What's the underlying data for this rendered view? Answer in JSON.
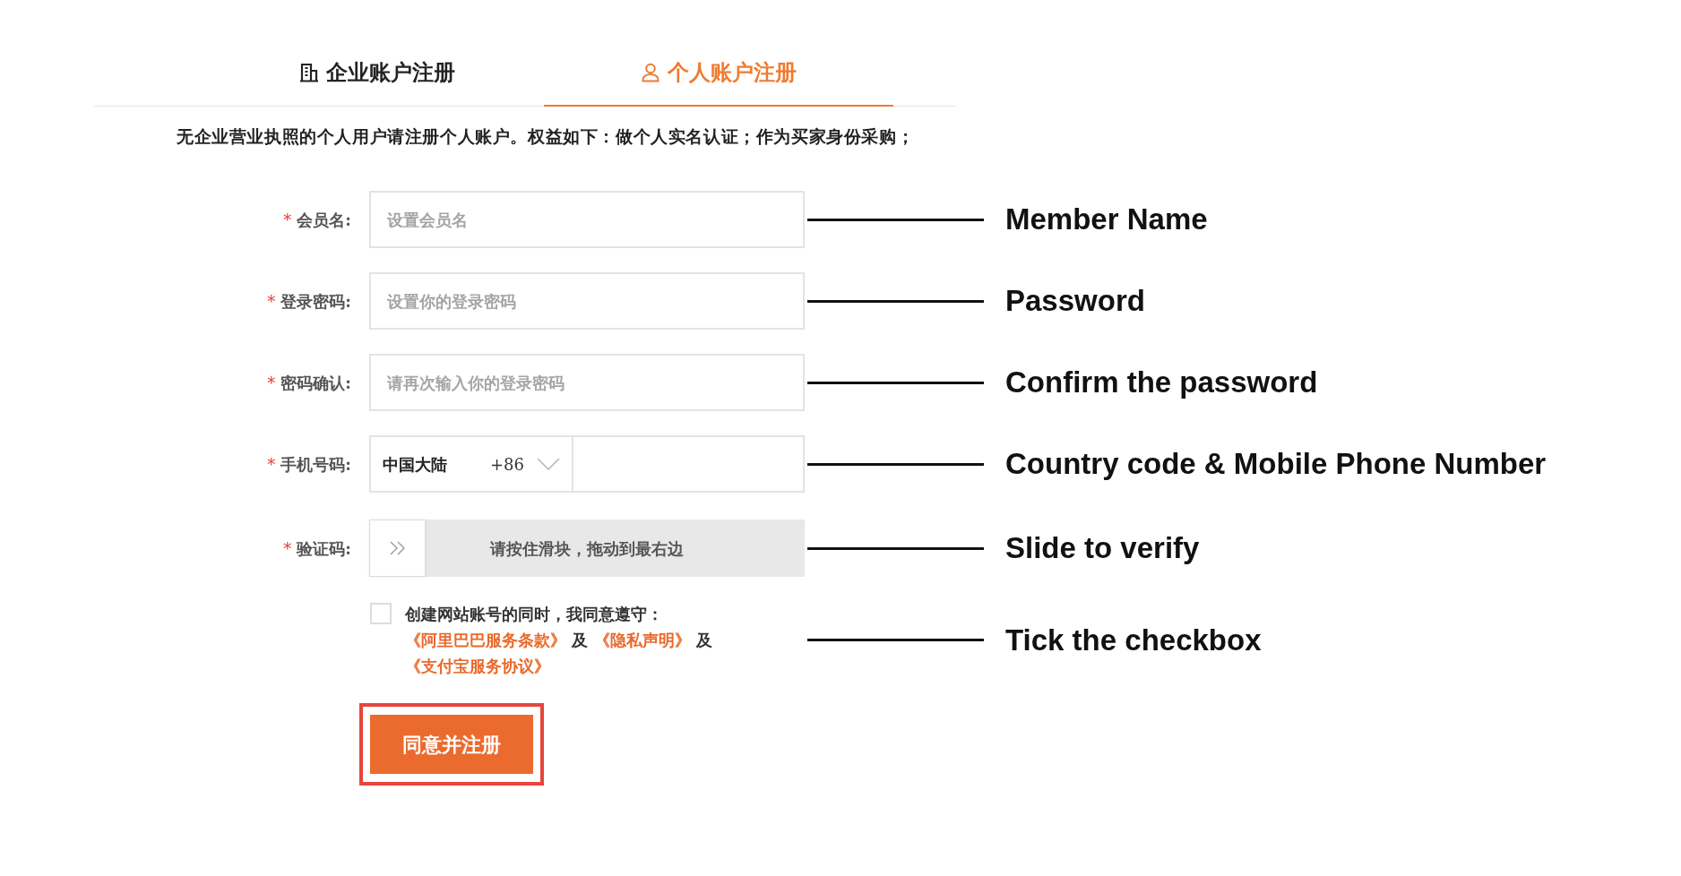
{
  "tabs": [
    {
      "kind": "company",
      "label": "企业账户注册",
      "selected": false
    },
    {
      "kind": "person",
      "label": "个人账户注册",
      "selected": true
    }
  ],
  "notice": "无企业营业执照的个人用户请注册个人账户。权益如下：做个人实名认证；作为买家身份采购；",
  "fields": [
    {
      "kind": "text",
      "required_mark": "*",
      "label": "会员名:",
      "placeholder": "设置会员名",
      "annotation": "Member Name"
    },
    {
      "kind": "text",
      "required_mark": "*",
      "label": "登录密码:",
      "placeholder": "设置你的登录密码",
      "annotation": "Password"
    },
    {
      "kind": "text",
      "required_mark": "*",
      "label": "密码确认:",
      "placeholder": "请再次输入你的登录密码",
      "annotation": "Confirm the password"
    },
    {
      "kind": "phone",
      "required_mark": "*",
      "label": "手机号码:",
      "country": "中国大陆",
      "code": "+86",
      "annotation": "Country code & Mobile Phone Number"
    },
    {
      "kind": "slider",
      "required_mark": "*",
      "label": "验证码:",
      "hint": "请按住滑块，拖动到最右边",
      "level": 0,
      "annotation": "Slide to verify"
    }
  ],
  "agreement": {
    "checked": false,
    "intro": "创建网站账号的同时，我同意遵守：",
    "parts": [
      {
        "kind": "link",
        "text": "《阿里巴巴服务条款》"
      },
      {
        "kind": "text",
        "text": "及"
      },
      {
        "kind": "link",
        "text": "《隐私声明》"
      },
      {
        "kind": "text",
        "text": "及"
      },
      {
        "kind": "link",
        "text": "《支付宝服务协议》"
      }
    ],
    "annotation": "Tick the checkbox"
  },
  "submit_button": {
    "label": "同意并注册",
    "highlighted": true
  }
}
